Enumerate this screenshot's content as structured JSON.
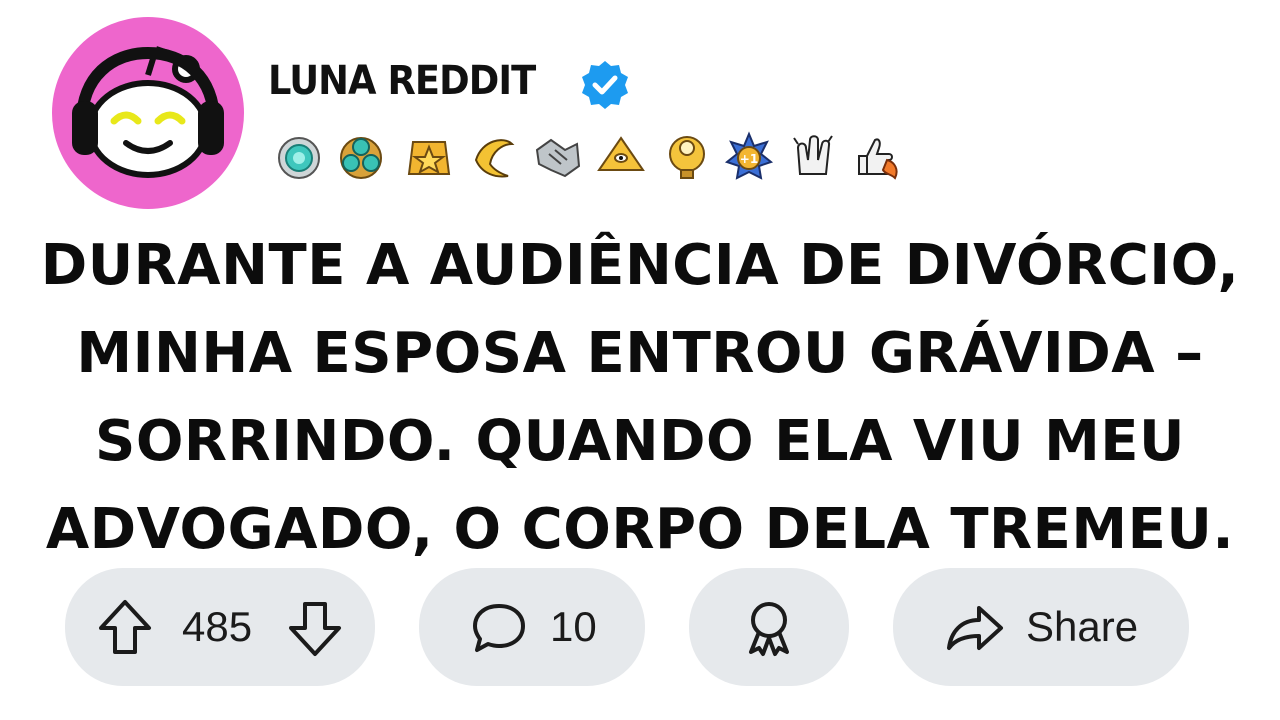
{
  "post": {
    "username": "LUNA REDDIT",
    "title_lines": [
      "DURANTE A AUDIÊNCIA DE DIVÓRCIO,",
      "MINHA ESPOSA ENTROU GRÁVIDA –",
      "SORRINDO. QUANDO ELA VIU MEU",
      "ADVOGADO, O CORPO DELA TREMEU."
    ]
  },
  "awards": [
    "medal-award",
    "gem-cluster-award",
    "star-award",
    "banana-award",
    "handshake-award",
    "pyramid-award",
    "trophy-award",
    "plus-one-award",
    "clapping-award",
    "thumbs-up-rocket-award"
  ],
  "actions": {
    "vote_count": "485",
    "comment_count": "10",
    "share_label": "Share"
  },
  "colors": {
    "avatar_bg": "#ee66cc",
    "verified": "#1d9bf0",
    "pill_bg": "#e6e9ec"
  }
}
